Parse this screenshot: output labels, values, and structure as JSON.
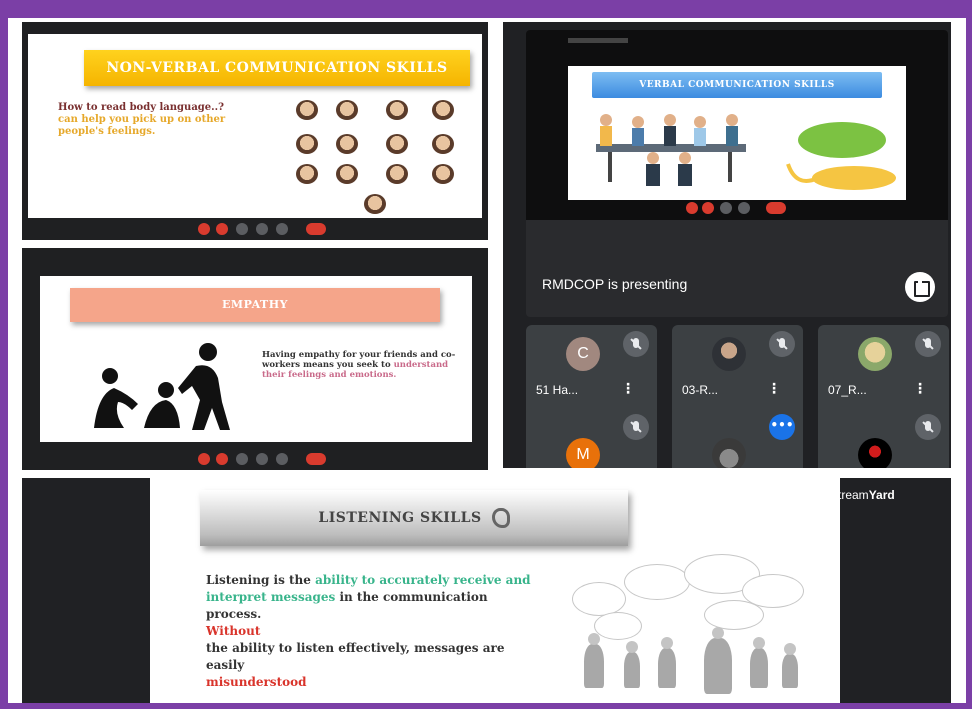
{
  "colors": {
    "frame": "#7b3fa6",
    "meet_bg": "#202124",
    "tile_bg": "#3c4043",
    "yellow_banner": "#f5b400",
    "salmon_banner": "#f5a58a",
    "blue_banner": "#3c8be0",
    "green_text": "#38b48b",
    "red_text": "#d9342b"
  },
  "nonverbal": {
    "title": "Non-verbal communication skills",
    "question": "How to read body language..?",
    "question_cont": "can help you pick up on other people's feelings."
  },
  "empathy": {
    "title": "Empathy",
    "text_1": "Having empathy for your friends and co-workers means you seek to ",
    "text_highlight": "understand their feelings and emotions."
  },
  "meet": {
    "verbal_title": "Verbal communication skills",
    "presenting_text": "RMDCOP is presenting",
    "participants": [
      {
        "name": "51 Ha...",
        "initial": "C",
        "avatar_color": "#a1887f"
      },
      {
        "name": "03-R...",
        "initial": "",
        "avatar_color": "#2e3136"
      },
      {
        "name": "07_R...",
        "initial": "",
        "avatar_color": "#c9b37a"
      },
      {
        "name": "",
        "initial": "M",
        "avatar_color": "#e8710a"
      },
      {
        "name": "",
        "initial": "",
        "avatar_color": "#5f6368"
      },
      {
        "name": "",
        "initial": "",
        "avatar_color": "#000000"
      }
    ],
    "icons": [
      "mic-off-icon",
      "more-vert-icon",
      "fullscreen-icon"
    ]
  },
  "listening": {
    "title": "Listening skills",
    "line_1": "Listening is the ",
    "line_1_green": "ability to accurately receive and interpret messages",
    "line_2": " in the communication process.",
    "line_3_red": "Without",
    "line_4": "the  ability to listen effectively, messages are easily",
    "line_5_red": "misunderstood",
    "watermark_a": "Stream",
    "watermark_b": "Yard"
  }
}
